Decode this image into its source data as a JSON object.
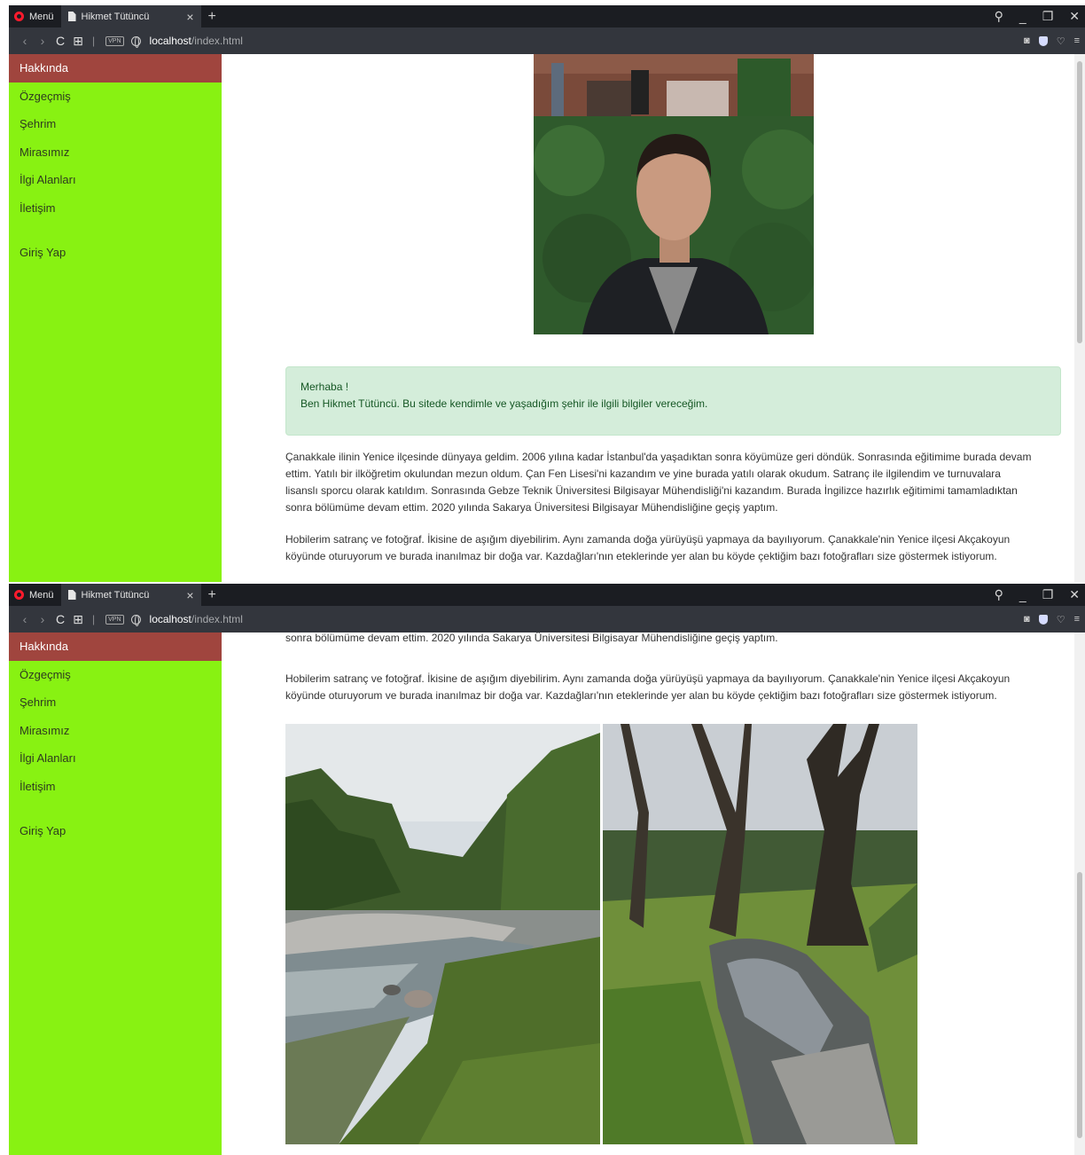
{
  "browser": {
    "menu_label": "Menü",
    "tab_title": "Hikmet Tütüncü",
    "tab_close": "×",
    "new_tab": "+",
    "url_host": "localhost",
    "url_path": "/index.html",
    "vpn_label": "VPN",
    "nav_back": "‹",
    "nav_forward": "›",
    "reload": "C",
    "speed_dial": "⊞",
    "search_icon": "⚲",
    "minimize": "_",
    "restore": "❐",
    "close": "✕",
    "snapshot": "◙",
    "heart": "♡",
    "easy_setup": "≡"
  },
  "sidebar": {
    "items": [
      {
        "label": "Hakkında"
      },
      {
        "label": "Özgeçmiş"
      },
      {
        "label": "Şehrim"
      },
      {
        "label": "Mirasımız"
      },
      {
        "label": "İlgi Alanları"
      },
      {
        "label": "İletişim"
      },
      {
        "label": "Giriş Yap"
      }
    ]
  },
  "alert": {
    "line1": "Merhaba !",
    "line2": "Ben Hikmet Tütüncü. Bu sitede kendimle ve yaşadığım şehir ile ilgili bilgiler vereceğim."
  },
  "paragraphs": {
    "p1_lines": [
      "Çanakkale ilinin Yenice ilçesinde dünyaya geldim. 2006 yılına kadar İstanbul'da yaşadıktan sonra köyümüze geri döndük. Sonrasında eğitimime burada devam",
      "ettim. Yatılı bir ilköğretim okulundan mezun oldum. Çan Fen Lisesi'ni kazandım ve yine burada yatılı olarak okudum. Satranç ile ilgilendim ve turnuvalara",
      "lisanslı sporcu olarak katıldım. Sonrasında Gebze Teknik Üniversitesi Bilgisayar Mühendisliği'ni kazandım. Burada İngilizce hazırlık eğitimimi tamamladıktan",
      "sonra bölümüme devam ettim. 2020 yılında Sakarya Üniversitesi Bilgisayar Mühendisliğine geçiş yaptım."
    ],
    "p2_lines": [
      "Hobilerim satranç ve fotoğraf. İkisine de aşığım diyebilirim. Aynı zamanda doğa yürüyüşü yapmaya da bayılıyorum. Çanakkale'nin Yenice ilçesi Akçakoyun",
      "köyünde oturuyorum ve burada inanılmaz bir doğa var. Kazdağları'nın eteklerinde yer alan bu köyde çektiğim bazı fotoğrafları size göstermek istiyorum."
    ]
  },
  "colors": {
    "sidebar_bg": "#88f212",
    "sidebar_active_bg": "#a0453e",
    "alert_bg": "#d4edda",
    "alert_text": "#155724",
    "browser_dark": "#1b1d22",
    "browser_bar": "#33363d"
  },
  "icons": {
    "page": "document-icon",
    "browser_logo": "opera-logo-icon",
    "portrait": "portrait-photo",
    "stream1": "river-photo",
    "stream2": "stream-tree-photo"
  }
}
